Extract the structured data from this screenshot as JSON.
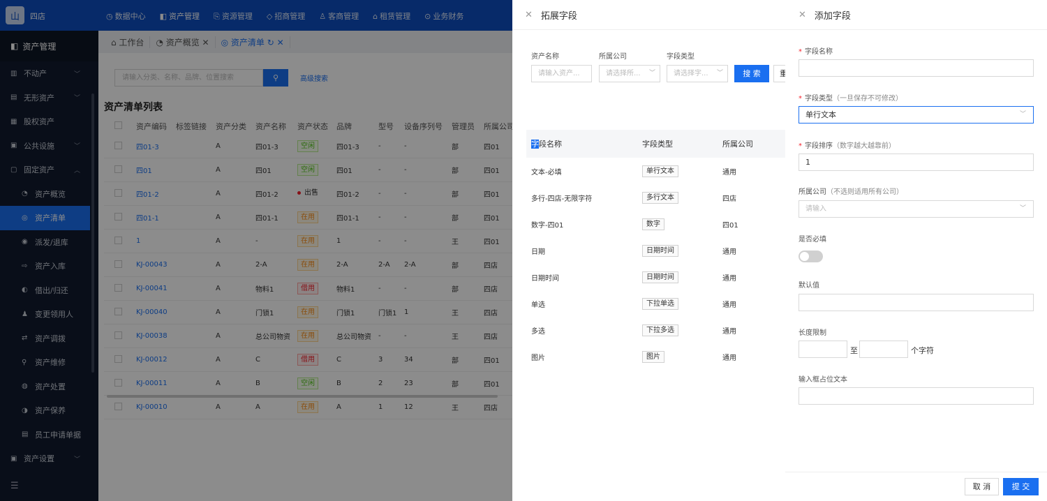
{
  "app": {
    "store_name": "四店",
    "logo_glyph": "山"
  },
  "topnav": [
    {
      "icon": "◷",
      "label": "数据中心"
    },
    {
      "icon": "◧",
      "label": "资产管理"
    },
    {
      "icon": "⎘",
      "label": "资源管理"
    },
    {
      "icon": "◇",
      "label": "招商管理"
    },
    {
      "icon": "♙",
      "label": "客商管理"
    },
    {
      "icon": "⌂",
      "label": "租赁管理"
    },
    {
      "icon": "⊙",
      "label": "业务财务"
    }
  ],
  "sidebar": {
    "header": "资产管理",
    "items": [
      {
        "label": "不动产",
        "icon": "▥",
        "arrow": "﹀"
      },
      {
        "label": "无形资产",
        "icon": "▤",
        "arrow": "﹀"
      },
      {
        "label": "股权资产",
        "icon": "▦",
        "arrow": ""
      },
      {
        "label": "公共设施",
        "icon": "▣",
        "arrow": "﹀"
      },
      {
        "label": "固定资产",
        "icon": "▢",
        "arrow": "︿"
      },
      {
        "label": "资产概览",
        "icon": "◔",
        "arrow": ""
      },
      {
        "label": "资产清单",
        "icon": "◎",
        "arrow": ""
      },
      {
        "label": "派发/退库",
        "icon": "◉",
        "arrow": ""
      },
      {
        "label": "资产入库",
        "icon": "⇨",
        "arrow": ""
      },
      {
        "label": "借出/归还",
        "icon": "◐",
        "arrow": ""
      },
      {
        "label": "变更领用人",
        "icon": "♟",
        "arrow": ""
      },
      {
        "label": "资产调拨",
        "icon": "⇄",
        "arrow": ""
      },
      {
        "label": "资产维修",
        "icon": "⚲",
        "arrow": ""
      },
      {
        "label": "资产处置",
        "icon": "◍",
        "arrow": ""
      },
      {
        "label": "资产保养",
        "icon": "◑",
        "arrow": ""
      },
      {
        "label": "员工申请单据",
        "icon": "▤",
        "arrow": ""
      },
      {
        "label": "资产设置",
        "icon": "▣",
        "arrow": "﹀"
      }
    ],
    "collapse_glyph": "☰"
  },
  "tabs": [
    {
      "label": "⌂ 工作台"
    },
    {
      "label": "◔ 资产概览 ✕"
    },
    {
      "label": "◎ 资产清单 ↻ ✕"
    }
  ],
  "search": {
    "placeholder": "请输入分类、名称、品牌、位置搜索",
    "button": "⚲",
    "advanced": "高级搜索"
  },
  "list": {
    "title": "资产清单列表",
    "columns": [
      "资产编码",
      "标签链接",
      "资产分类",
      "资产名称",
      "资产状态",
      "品牌",
      "型号",
      "设备序列号",
      "管理员",
      "所属公司"
    ],
    "rows": [
      [
        "四01-3",
        "",
        "A",
        "四01-3",
        "空闲",
        "四01-3",
        "-",
        "-",
        "部",
        "四01"
      ],
      [
        "四01",
        "",
        "A",
        "四01",
        "空闲",
        "四01",
        "-",
        "-",
        "部",
        "四01"
      ],
      [
        "四01-2",
        "",
        "A",
        "四01-2",
        "出售",
        "四01-2",
        "-",
        "-",
        "部",
        "四01"
      ],
      [
        "四01-1",
        "",
        "A",
        "四01-1",
        "在用",
        "四01-1",
        "-",
        "-",
        "部",
        "四01"
      ],
      [
        "1",
        "",
        "A",
        "-",
        "在用",
        "1",
        "-",
        "-",
        "王",
        "四01"
      ],
      [
        "KJ-00043",
        "",
        "A",
        "2-A",
        "在用",
        "2-A",
        "2-A",
        "2-A",
        "部",
        "四店"
      ],
      [
        "KJ-00041",
        "",
        "A",
        "物料1",
        "借用",
        "物料1",
        "-",
        "-",
        "部",
        "四店"
      ],
      [
        "KJ-00040",
        "",
        "A",
        "门锁1",
        "在用",
        "门锁1",
        "门锁1",
        "1",
        "王",
        "四店"
      ],
      [
        "KJ-00038",
        "",
        "A",
        "总公司物资",
        "在用",
        "总公司物资",
        "-",
        "-",
        "王",
        "四店"
      ],
      [
        "KJ-00012",
        "",
        "A",
        "C",
        "借用",
        "C",
        "3",
        "34",
        "部",
        "四01"
      ],
      [
        "KJ-00011",
        "",
        "A",
        "B",
        "空闲",
        "B",
        "2",
        "23",
        "部",
        "四01"
      ],
      [
        "KJ-00010",
        "",
        "A",
        "A",
        "在用",
        "A",
        "1",
        "12",
        "王",
        "四店"
      ]
    ]
  },
  "extend_drawer": {
    "title": "拓展字段",
    "close": "✕",
    "filter_labels": [
      "资产名称",
      "所属公司",
      "字段类型"
    ],
    "filter_placeholders": [
      "请输入资产...",
      "请选择所...",
      "请选择字..."
    ],
    "search_button": "搜 索",
    "reset_button": "重",
    "table_head_sel": "字",
    "table_head_rest": "段名称",
    "table_columns": [
      "字段类型",
      "所属公司"
    ],
    "rows": [
      {
        "name": "文本-必填",
        "type": "单行文本",
        "company": "通用"
      },
      {
        "name": "多行-四店-无限字符",
        "type": "多行文本",
        "company": "四店"
      },
      {
        "name": "数字-四01",
        "type": "数字",
        "company": "四01"
      },
      {
        "name": "日期",
        "type": "日期时间",
        "company": "通用"
      },
      {
        "name": "日期时间",
        "type": "日期时间",
        "company": "通用"
      },
      {
        "name": "单选",
        "type": "下拉单选",
        "company": "通用"
      },
      {
        "name": "多选",
        "type": "下拉多选",
        "company": "通用"
      },
      {
        "name": "图片",
        "type": "图片",
        "company": "通用"
      }
    ]
  },
  "add_drawer": {
    "title": "添加字段",
    "close": "✕",
    "field_name": {
      "label": "字段名称",
      "value": ""
    },
    "field_type": {
      "label": "字段类型",
      "hint": "（一旦保存不可修改）",
      "value": "单行文本"
    },
    "field_order": {
      "label": "字段排序",
      "hint": "（数字越大越靠前）",
      "value": "1"
    },
    "company": {
      "label": "所属公司",
      "hint": "（不选则适用所有公司）",
      "placeholder": "请输入"
    },
    "required": {
      "label": "是否必填",
      "on": false
    },
    "default_value": {
      "label": "默认值",
      "value": ""
    },
    "length": {
      "label": "长度限制",
      "to": "至",
      "unit": "个字符"
    },
    "placeholder_text": {
      "label": "输入框占位文本",
      "value": ""
    },
    "required_mark": "*",
    "cancel": "取 消",
    "submit": "提 交"
  }
}
